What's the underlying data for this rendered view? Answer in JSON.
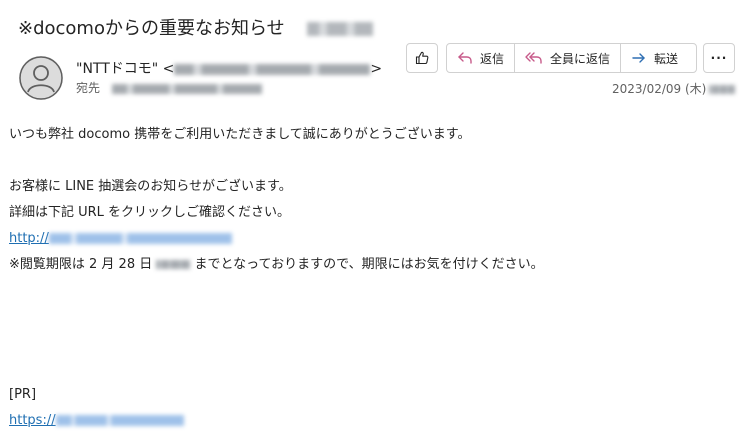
{
  "subject": "※docomoからの重要なお知らせ",
  "sender": {
    "name": "\"NTTドコモ\" <",
    "name_close": ">",
    "to_label": "宛先"
  },
  "toolbar": {
    "like_icon": "thumbs-up-icon",
    "reply_label": "返信",
    "reply_all_label": "全員に返信",
    "forward_label": "転送",
    "more_label": "···"
  },
  "date": "2023/02/09 (木)",
  "body": {
    "greeting": "いつも弊社 docomo 携帯をご利用いただきまして誠にありがとうございます。",
    "line1": "お客様に LINE 抽選会のお知らせがございます。",
    "line2": "詳細は下記 URL をクリックしご確認ください。",
    "link1_prefix": "http://",
    "notice_prefix": "※閲覧期限は 2 月 28 日",
    "notice_suffix": "までとなっておりますので、期限にはお気を付けください。",
    "pr": "[PR]",
    "link2_prefix": "https://"
  },
  "colors": {
    "link": "#1f6fb2",
    "reply_icon": "#c75a8a",
    "forward_icon": "#2f6fb3"
  }
}
